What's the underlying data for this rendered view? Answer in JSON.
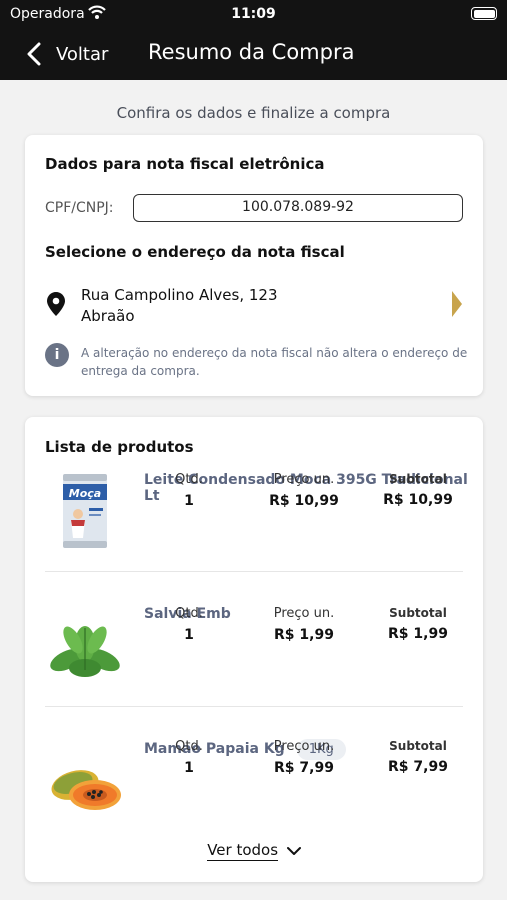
{
  "status_bar": {
    "carrier": "Operadora",
    "time": "11:09"
  },
  "nav": {
    "back_label": "Voltar",
    "title": "Resumo da Compra"
  },
  "subtitle": "Confira os dados e finalize a compra",
  "invoice": {
    "title": "Dados para nota fiscal eletrônica",
    "cpf_label": "CPF/CNPJ:",
    "cpf_value": "100.078.089-92",
    "address_title": "Selecione o endereço da nota fiscal",
    "address_line1": "Rua Campolino Alves, 123",
    "address_line2": "Abraão",
    "info_text": "A alteração no endereço da nota fiscal não altera o endereço de entrega da compra."
  },
  "products": {
    "title": "Lista de produtos",
    "col_qtd": "Qtd.",
    "col_preco": "Preço un.",
    "col_subtotal": "Subtotal",
    "items": [
      {
        "name": "Leite Condensado Moca 395G Tradicional Lt",
        "tag": "",
        "qtd": "1",
        "preco": "R$ 10,99",
        "subtotal": "R$ 10,99",
        "image": "condensed-milk-can",
        "image_text": "Moça"
      },
      {
        "name": "Salvia Emb",
        "tag": "",
        "qtd": "1",
        "preco": "R$ 1,99",
        "subtotal": "R$ 1,99",
        "image": "sage-leaves"
      },
      {
        "name": "Mamao Papaia Kg",
        "tag": "1Kg",
        "qtd": "1",
        "preco": "R$ 7,99",
        "subtotal": "R$ 7,99",
        "image": "papaya"
      }
    ],
    "ver_todos": "Ver todos"
  },
  "colors": {
    "header_bg": "#131313",
    "accent_arrow": "#c8a44d",
    "product_name": "#5c6680",
    "info": "#6a7386"
  }
}
